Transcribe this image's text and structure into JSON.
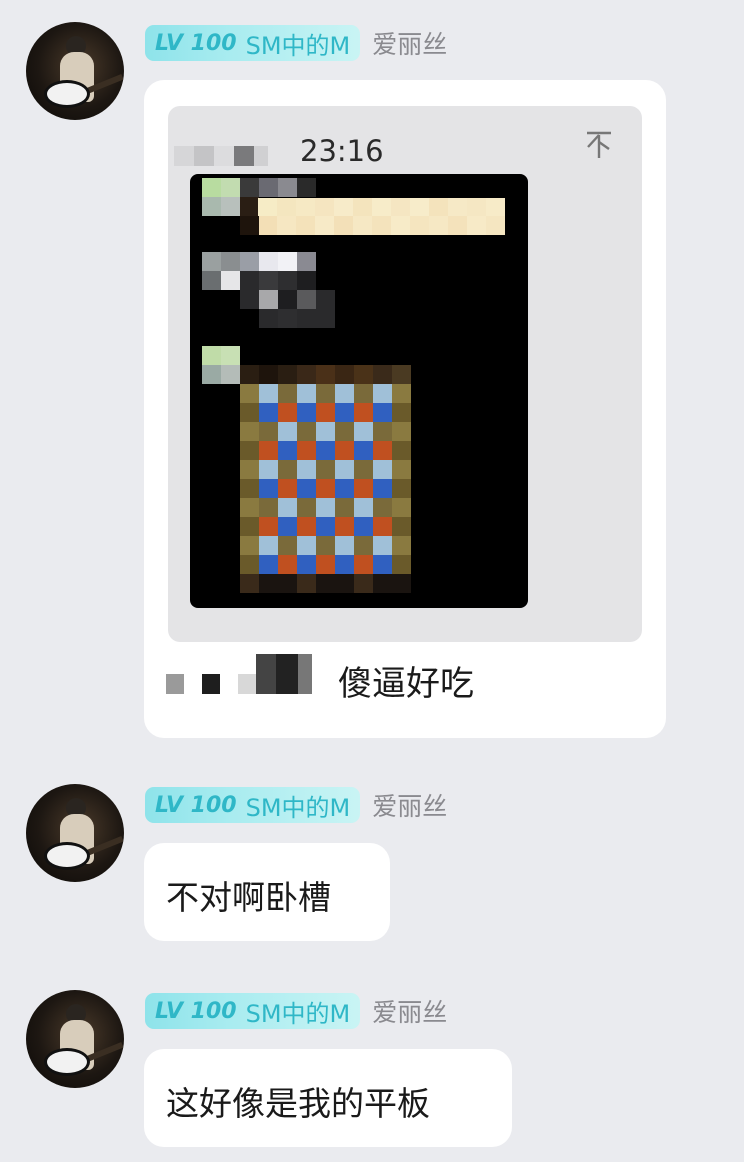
{
  "messages": [
    {
      "level": "LV 100",
      "title": "SM中的M",
      "nickname": "爱丽丝",
      "quote": {
        "time": "23:16",
        "pin_icon": "arrow-top-icon",
        "pin_glyph": "不"
      },
      "caption": "傻逼好吃"
    },
    {
      "level": "LV 100",
      "title": "SM中的M",
      "nickname": "爱丽丝",
      "text": "不对啊卧槽"
    },
    {
      "level": "LV 100",
      "title": "SM中的M",
      "nickname": "爱丽丝",
      "text": "这好像是我的平板"
    }
  ],
  "colors": {
    "background": "#eaebef",
    "badge_text": "#2fb7c7",
    "badge_bg": "#a9ecf0",
    "nickname": "#8a8a8f",
    "bubble": "#ffffff"
  }
}
